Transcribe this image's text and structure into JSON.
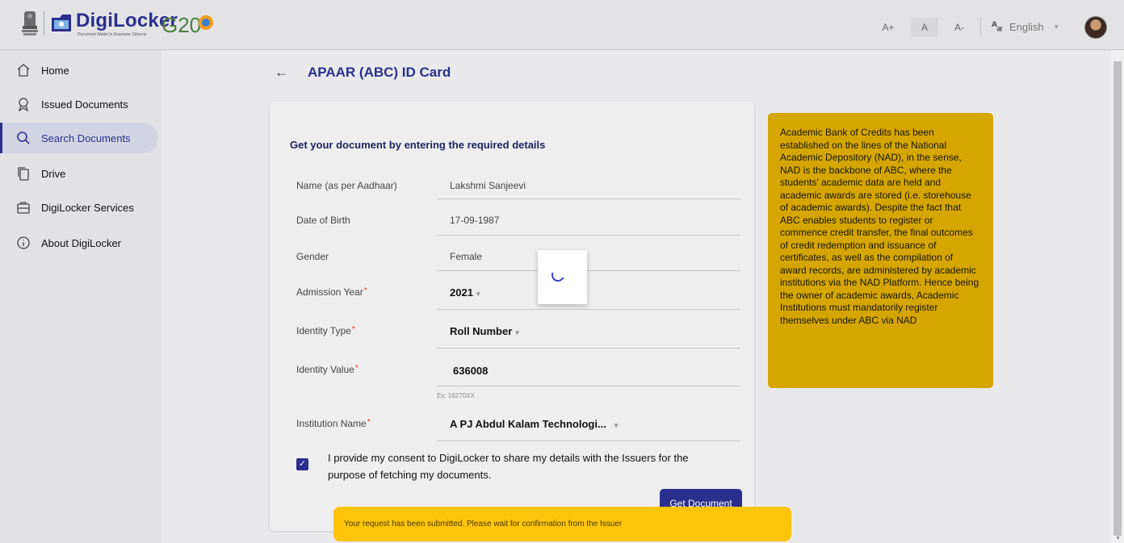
{
  "header": {
    "brand": "DigiLocker",
    "tagline": "Document Wallet to Empower Citizens",
    "event_logo": "G20",
    "font_increase": "A+",
    "font_normal": "A",
    "font_decrease": "A-",
    "language_icon": "a-hindi-translate-icon",
    "language": "English",
    "language_caret": "▾"
  },
  "sidebar": {
    "items": [
      {
        "label": "Home",
        "icon": "home-icon"
      },
      {
        "label": "Issued Documents",
        "icon": "award-icon"
      },
      {
        "label": "Search Documents",
        "icon": "search-icon"
      },
      {
        "label": "Drive",
        "icon": "file-copy-icon"
      },
      {
        "label": "DigiLocker Services",
        "icon": "briefcase-icon"
      },
      {
        "label": "About DigiLocker",
        "icon": "info-icon"
      }
    ],
    "active_index": 2
  },
  "page": {
    "back": "←",
    "title": "APAAR (ABC) ID Card"
  },
  "form": {
    "heading": "Get your document by entering the required details",
    "fields": [
      {
        "label": "Name (as per Aadhaar)",
        "value": "Lakshmi Sanjeevi",
        "required": false
      },
      {
        "label": "Date of Birth",
        "value": "17-09-1987",
        "required": false
      },
      {
        "label": "Gender",
        "value": "Female",
        "required": false
      },
      {
        "label": "Admission Year",
        "value": "2021",
        "required": true
      },
      {
        "label": "Identity Type",
        "value": "Roll Number",
        "required": true
      },
      {
        "label": "Identity Value",
        "value": "636008",
        "required": true
      },
      {
        "label": "Institution Name",
        "value": "A PJ Abdul Kalam Technologi...",
        "required": true
      }
    ],
    "required_mark": "*",
    "identity_hint": "Ex: 16270XX",
    "dropdown_caret": "▾",
    "consent_checked": true,
    "consent_check_glyph": "✓",
    "consent_text": "I provide my consent to DigiLocker to share my details with the Issuers for the purpose of fetching my documents.",
    "submit_label": "Get Document"
  },
  "info": {
    "text": "Academic Bank of Credits has been established on the lines of the National Academic Depository (NAD), in the sense, NAD is the backbone of ABC, where the students' academic data are held and academic awards are stored (i.e. storehouse of academic awards). Despite the fact that ABC enables students to register or commence credit transfer, the final outcomes of credit redemption and issuance of certificates, as well as the compilation of award records, are administered by academic institutions via the NAD Platform. Hence being the owner of academic awards, Academic Institutions must mandatorily register themselves under ABC via NAD"
  },
  "toast": {
    "message": "Your request has been submitted. Please wait for confirmation from the Issuer"
  },
  "colors": {
    "brand": "#2a2f8d",
    "info_bg": "#d5a600",
    "toast_bg": "#fdc40a"
  }
}
